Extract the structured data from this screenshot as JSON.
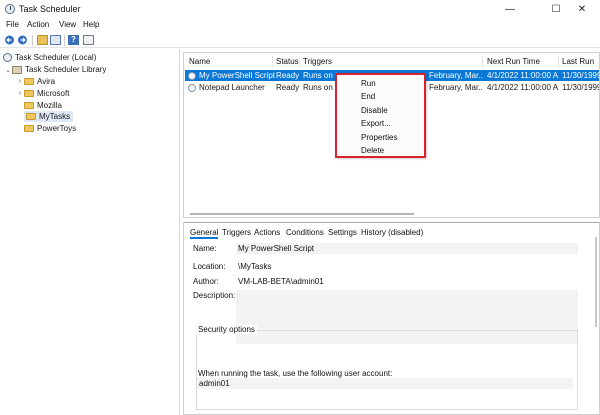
{
  "window": {
    "title": "Task Scheduler",
    "controls": {
      "minimize": "—",
      "maximize": "☐",
      "close": "✕"
    }
  },
  "menu": [
    "File",
    "Action",
    "View",
    "Help"
  ],
  "toolbar": {
    "help_glyph": "?"
  },
  "tree": {
    "root": "Task Scheduler (Local)",
    "library": "Task Scheduler Library",
    "folders": [
      "Avira",
      "Microsoft",
      "Mozilla",
      "MyTasks",
      "PowerToys"
    ],
    "selected": "MyTasks"
  },
  "task_list": {
    "columns": [
      "Name",
      "Status",
      "Triggers",
      "Next Run Time",
      "Last Run"
    ],
    "rows": [
      {
        "name": "My PowerShell Script",
        "status": "Ready",
        "triggers": "Runs on the",
        "triggers_tail": "February, Mar...",
        "next_run": "4/1/2022 11:00:00 A...",
        "last_run": "11/30/1999"
      },
      {
        "name": "Notepad Launcher",
        "status": "Ready",
        "triggers": "Runs on the",
        "triggers_tail": "February, Mar...",
        "next_run": "4/1/2022 11:00:00 A...",
        "last_run": "11/30/1999"
      }
    ]
  },
  "context_menu": [
    "Run",
    "End",
    "Disable",
    "Export...",
    "Properties",
    "Delete"
  ],
  "details": {
    "tabs": [
      "General",
      "Triggers",
      "Actions",
      "Conditions",
      "Settings",
      "History (disabled)"
    ],
    "active_tab": "General",
    "name_label": "Name:",
    "name_value": "My PowerShell Script",
    "location_label": "Location:",
    "location_value": "\\MyTasks",
    "author_label": "Author:",
    "author_value": "VM-LAB-BETA\\admin01",
    "description_label": "Description:",
    "security_title": "Security options",
    "security_text": "When running the task, use the following user account:",
    "account_value": "admin01"
  },
  "colors": {
    "selection": "#0a78d7",
    "highlight_box": "#d6232e"
  }
}
